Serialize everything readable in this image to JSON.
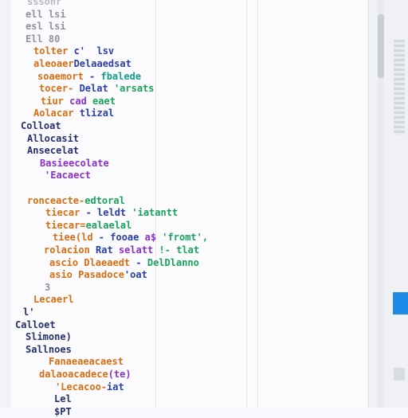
{
  "colors": {
    "background": "#fbfbfd",
    "accent": "#1c8ae6",
    "orange": "#d86e12",
    "purple": "#8a32c8",
    "blue": "#2a3fa8",
    "green": "#1aa35c",
    "teal": "#119e87",
    "navy": "#26306e"
  },
  "lines": [
    {
      "text": [
        {
          "t": "sssonr",
          "c": "#b5b8bf"
        }
      ]
    },
    {
      "text": [
        {
          "t": "ell lsi",
          "c": "#8f939b"
        }
      ]
    },
    {
      "text": [
        {
          "t": "esl lsi",
          "c": "#8f939b"
        }
      ]
    },
    {
      "text": [
        {
          "t": "Ell 80",
          "c": "#8f939b"
        }
      ]
    },
    {
      "text": [
        {
          "t": "tolter ",
          "c": "#d86e12"
        },
        {
          "t": "c'  lsv",
          "c": "#2a3fa8"
        }
      ]
    },
    {
      "text": [
        {
          "t": "aleoaer",
          "c": "#d86e12"
        },
        {
          "t": "Delaaedsat",
          "c": "#2a3fa8"
        }
      ]
    },
    {
      "text": [
        {
          "t": "soaemort ",
          "c": "#d86e12"
        },
        {
          "t": "- ",
          "c": "#2a3fa8"
        },
        {
          "t": "fbalede",
          "c": "#119e87"
        }
      ]
    },
    {
      "text": [
        {
          "t": "tocer- ",
          "c": "#d86e12"
        },
        {
          "t": "Delat ",
          "c": "#2a3fa8"
        },
        {
          "t": "'arsats",
          "c": "#1aa35c"
        }
      ]
    },
    {
      "text": [
        {
          "t": "tiur ",
          "c": "#d86e12"
        },
        {
          "t": "cad ",
          "c": "#8a32c8"
        },
        {
          "t": "eaet",
          "c": "#1aa35c"
        }
      ]
    },
    {
      "text": [
        {
          "t": "Aolacar ",
          "c": "#d86e12"
        },
        {
          "t": "tlizal",
          "c": "#2a3fa8"
        }
      ]
    },
    {
      "text": [
        {
          "t": "Colloat",
          "c": "#26306e"
        }
      ]
    },
    {
      "text": [
        {
          "t": "Allocasit",
          "c": "#26306e"
        }
      ]
    },
    {
      "text": [
        {
          "t": "Ansecelat",
          "c": "#26306e"
        }
      ]
    },
    {
      "text": [
        {
          "t": "Basieecolate",
          "c": "#8a32c8"
        }
      ]
    },
    {
      "text": [
        {
          "t": "'Eacaect",
          "c": "#8a32c8"
        }
      ]
    },
    {
      "text": [
        {
          "t": "",
          "c": "#26306e"
        }
      ]
    },
    {
      "text": [
        {
          "t": "ronceacte-",
          "c": "#d86e12"
        },
        {
          "t": "edtoral",
          "c": "#1aa35c"
        }
      ]
    },
    {
      "text": [
        {
          "t": "tiecar ",
          "c": "#d86e12"
        },
        {
          "t": "- leldt ",
          "c": "#2a3fa8"
        },
        {
          "t": "'iatantt",
          "c": "#1aa35c"
        }
      ]
    },
    {
      "text": [
        {
          "t": "tiecar=",
          "c": "#d86e12"
        },
        {
          "t": "ealaelal",
          "c": "#1aa35c"
        }
      ]
    },
    {
      "text": [
        {
          "t": "tiee(ld ",
          "c": "#d86e12"
        },
        {
          "t": "- ",
          "c": "#2a3fa8"
        },
        {
          "t": "fooae ",
          "c": "#2a3fa8"
        },
        {
          "t": "a$ ",
          "c": "#8a32c8"
        },
        {
          "t": "'fromt',",
          "c": "#1aa35c"
        }
      ]
    },
    {
      "text": [
        {
          "t": "rolacion ",
          "c": "#d86e12"
        },
        {
          "t": "Rat ",
          "c": "#2a3fa8"
        },
        {
          "t": "selatt ",
          "c": "#8a32c8"
        },
        {
          "t": "!- tlat",
          "c": "#1aa35c"
        }
      ]
    },
    {
      "text": [
        {
          "t": "ascio ",
          "c": "#d86e12"
        },
        {
          "t": "Dlaeaedt ",
          "c": "#d86e12"
        },
        {
          "t": "- ",
          "c": "#2a3fa8"
        },
        {
          "t": "DelDlanno",
          "c": "#1aa35c"
        }
      ]
    },
    {
      "text": [
        {
          "t": "asio ",
          "c": "#d86e12"
        },
        {
          "t": "Pasadoce",
          "c": "#d86e12"
        },
        {
          "t": "'oat",
          "c": "#2a3fa8"
        }
      ]
    },
    {
      "text": [
        {
          "t": "3",
          "c": "#8f939b"
        }
      ]
    },
    {
      "text": [
        {
          "t": "Lecaerl",
          "c": "#d86e12"
        }
      ]
    },
    {
      "text": [
        {
          "t": "l'",
          "c": "#26306e"
        }
      ]
    },
    {
      "text": [
        {
          "t": "Calloet",
          "c": "#26306e"
        }
      ]
    },
    {
      "text": [
        {
          "t": "Slimone)",
          "c": "#26306e"
        }
      ]
    },
    {
      "text": [
        {
          "t": "Sallnoes",
          "c": "#26306e"
        }
      ]
    },
    {
      "text": [
        {
          "t": "Fanaeaeacaest",
          "c": "#d86e12"
        }
      ]
    },
    {
      "text": [
        {
          "t": "dalaoacadece",
          "c": "#d86e12"
        },
        {
          "t": "(te)",
          "c": "#8a32c8"
        }
      ]
    },
    {
      "text": [
        {
          "t": "'Lecacoo-",
          "c": "#d86e12"
        },
        {
          "t": "iat",
          "c": "#2a3fa8"
        }
      ]
    },
    {
      "text": [
        {
          "t": "Lel",
          "c": "#26306e"
        }
      ]
    },
    {
      "text": [
        {
          "t": "$PT",
          "c": "#26306e"
        }
      ]
    }
  ]
}
